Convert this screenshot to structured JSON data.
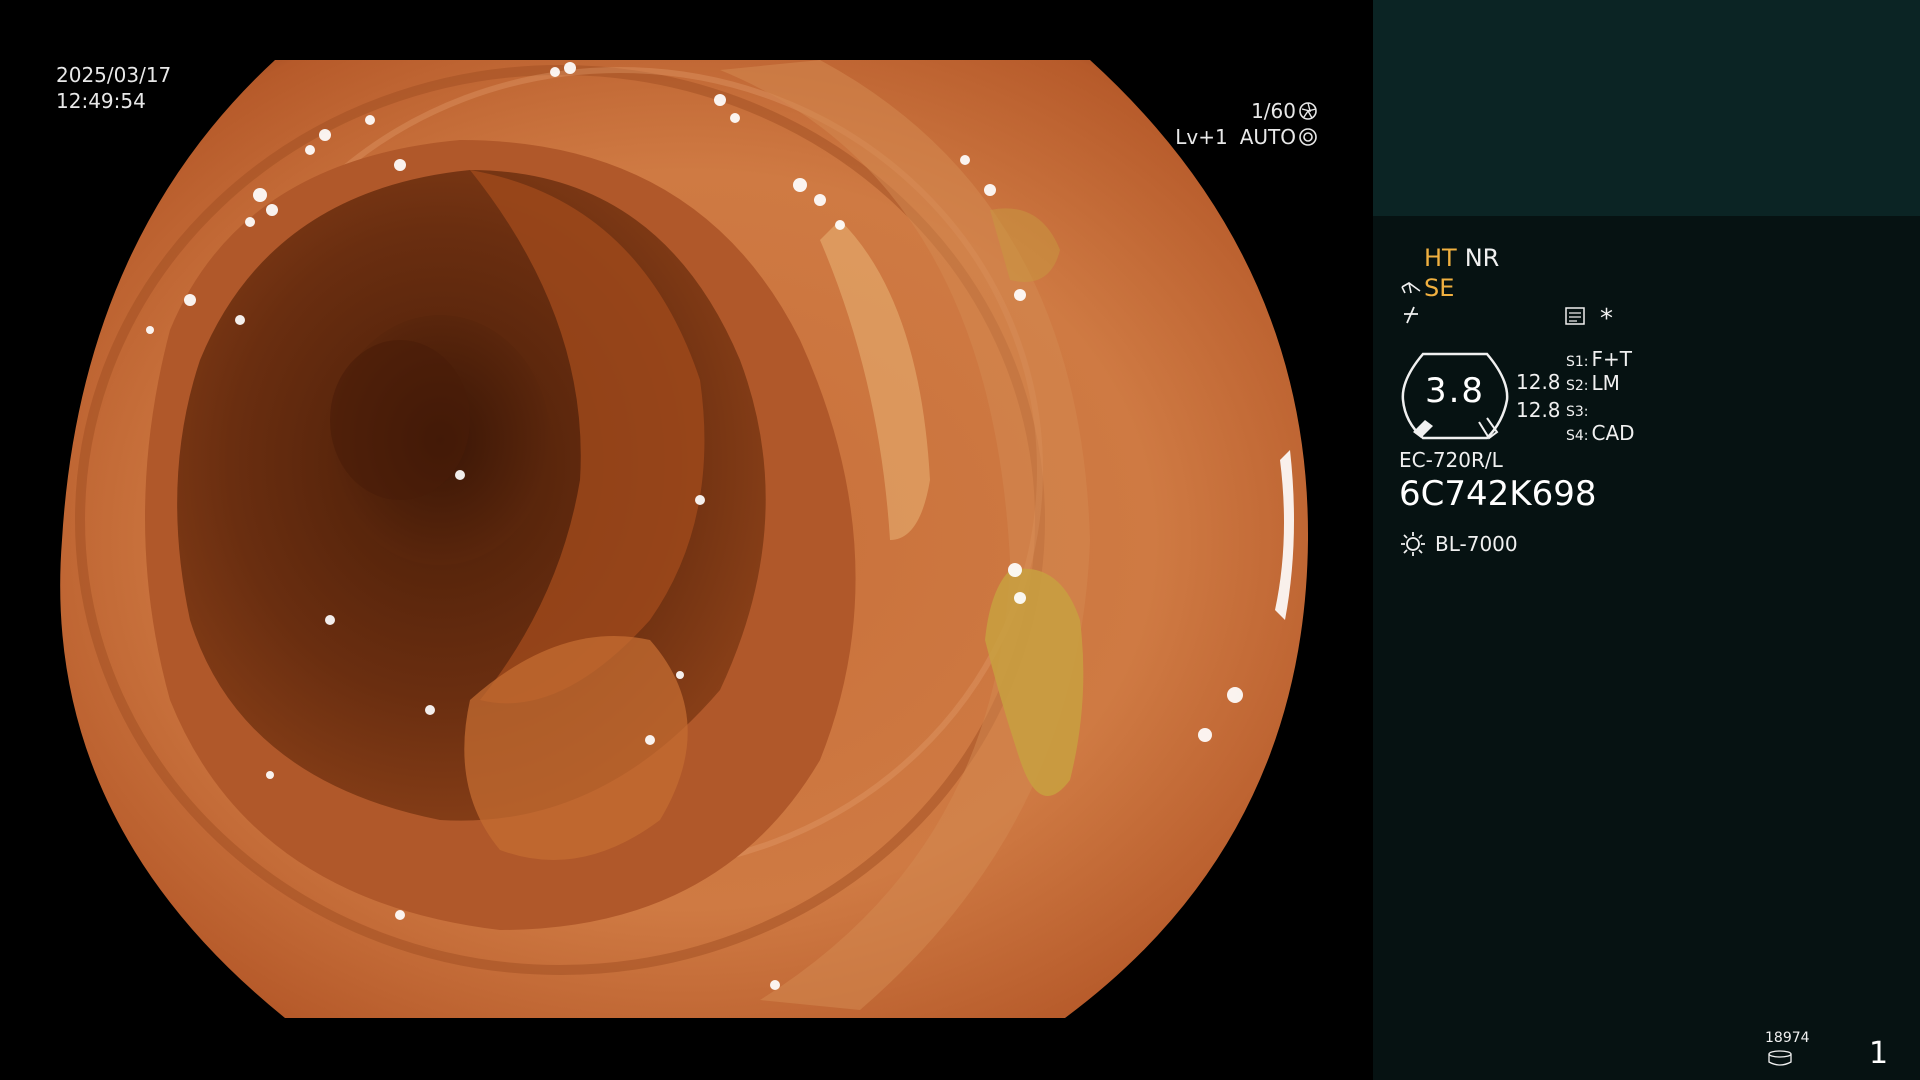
{
  "overlay": {
    "date": "2025/03/17",
    "time": "12:49:54",
    "shutter_speed": "1/60",
    "level": "Lv+1",
    "exposure_mode": "AUTO"
  },
  "panel": {
    "mode_primary": "HT",
    "mode_secondary": "NR",
    "se_label": "SE",
    "dial_value": "3.8",
    "gain_top": "12.8",
    "gain_bottom": "12.8",
    "switches": [
      {
        "key": "S1:",
        "value": "F+T"
      },
      {
        "key": "S2:",
        "value": "LM"
      },
      {
        "key": "S3:",
        "value": ""
      },
      {
        "key": "S4:",
        "value": "CAD"
      }
    ],
    "asterisk": "*",
    "scope_model": "EC-720R/L",
    "scope_serial": "6C742K698",
    "light_source": "BL-7000",
    "image_counter": "18974",
    "page_number": "1"
  },
  "colors": {
    "panel_bg": "#061212",
    "preview_bg": "#0b2424",
    "accent": "#f0b040",
    "text": "#f0f0f0"
  },
  "icons": [
    "shutter-icon",
    "auto-exposure-icon",
    "scope-tip-icon",
    "sharpness-icon",
    "form-icon",
    "light-bulb-icon",
    "storage-icon"
  ]
}
